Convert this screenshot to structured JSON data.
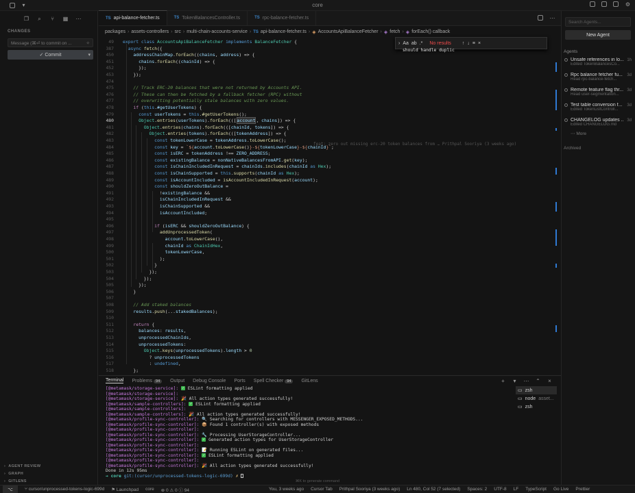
{
  "window": {
    "title": "core"
  },
  "sidebar": {
    "section_title": "CHANGES",
    "commit_placeholder": "Message (⌘⏎ to commit on ...",
    "commit_button": "✓ Commit",
    "bottom_sections": [
      "AGENT REVIEW",
      "GRAPH",
      "GITLENS"
    ]
  },
  "tabs": [
    {
      "name": "api-balance-fetcher.ts",
      "active": true
    },
    {
      "name": "TokenBalancesController.ts",
      "active": false
    },
    {
      "name": "rpc-balance-fetcher.ts",
      "active": false
    }
  ],
  "breadcrumbs": [
    "packages",
    "assets-controllers",
    "src",
    "multi-chain-accounts-service",
    "api-balance-fetcher.ts",
    "AccountsApiBalanceFetcher",
    "fetch",
    "forEach() callback"
  ],
  "find": {
    "term": "should handle duplicate",
    "case_label": "Aa",
    "result": "No results"
  },
  "code": {
    "line_numbers": [
      "49",
      "387",
      "450",
      "451",
      "452",
      "453",
      "474",
      "475",
      "476",
      "477",
      "478",
      "479",
      "480",
      "481",
      "482",
      "483",
      "484",
      "485",
      "486",
      "487",
      "488",
      "489",
      "490",
      "491",
      "492",
      "493",
      "494",
      "495",
      "496",
      "497",
      "498",
      "499",
      "500",
      "501",
      "502",
      "503",
      "504",
      "505",
      "506",
      "507",
      "508",
      "509",
      "510",
      "511",
      "512",
      "513",
      "514",
      "515",
      "516",
      "517",
      "518",
      "519"
    ],
    "current_line": "480",
    "blame": "feat: zero out missing erc-20 token balances from … Prithpal Sooriya (3 weeks ago)"
  },
  "panel": {
    "tabs": [
      {
        "label": "Terminal",
        "active": true
      },
      {
        "label": "Problems",
        "badge": "94"
      },
      {
        "label": "Output"
      },
      {
        "label": "Debug Console"
      },
      {
        "label": "Ports"
      },
      {
        "label": "Spell Checker",
        "badge": "94"
      },
      {
        "label": "GitLens"
      }
    ],
    "terminal_lines": [
      {
        "pkg": "[@metamask/storage-service]:",
        "ok": true,
        "msg": "ESLint formatting applied"
      },
      {
        "pkg": "[@metamask/storage-service]:",
        "ok": false,
        "msg": ""
      },
      {
        "pkg": "[@metamask/storage-service]:",
        "ok": false,
        "msg": "🎉 All action types generated successfully!"
      },
      {
        "pkg": "[@metamask/sample-controllers]:",
        "ok": true,
        "msg": "ESLint formatting applied"
      },
      {
        "pkg": "[@metamask/sample-controllers]:",
        "ok": false,
        "msg": ""
      },
      {
        "pkg": "[@metamask/sample-controllers]:",
        "ok": false,
        "msg": "🎉 All action types generated successfully!"
      },
      {
        "pkg": "[@metamask/profile-sync-controller]:",
        "ok": false,
        "msg": "🔍 Searching for controllers with MESSENGER_EXPOSED_METHODS..."
      },
      {
        "pkg": "[@metamask/profile-sync-controller]:",
        "ok": false,
        "msg": "📦 Found 1 controller(s) with exposed methods"
      },
      {
        "pkg": "[@metamask/profile-sync-controller]:",
        "ok": false,
        "msg": ""
      },
      {
        "pkg": "[@metamask/profile-sync-controller]:",
        "ok": false,
        "msg": "🔧 Processing UserStorageController..."
      },
      {
        "pkg": "[@metamask/profile-sync-controller]:",
        "ok": true,
        "msg": "Generated action types for UserStorageController"
      },
      {
        "pkg": "[@metamask/profile-sync-controller]:",
        "ok": false,
        "msg": ""
      },
      {
        "pkg": "[@metamask/profile-sync-controller]:",
        "ok": false,
        "msg": "📝 Running ESLint on generated files..."
      },
      {
        "pkg": "[@metamask/profile-sync-controller]:",
        "ok": true,
        "msg": "ESLint formatting applied"
      },
      {
        "pkg": "[@metamask/profile-sync-controller]:",
        "ok": false,
        "msg": ""
      },
      {
        "pkg": "[@metamask/profile-sync-controller]:",
        "ok": false,
        "msg": "🎉 All action types generated successfully!"
      }
    ],
    "done_line": "Done in 12s 95ms",
    "prompt": {
      "arrow": "→",
      "dir": "core",
      "git": "git:(cursor/unprocessed-tokens-logic-699d)",
      "suffix": "✗"
    },
    "terminals": [
      {
        "name": "zsh",
        "detail": ""
      },
      {
        "name": "node",
        "detail": "asset..."
      },
      {
        "name": "zsh",
        "detail": ""
      }
    ]
  },
  "agents": {
    "search_placeholder": "Search Agents...",
    "new_button": "New Agent",
    "heading": "Agents",
    "items": [
      {
        "title": "Unsafe references in lo...",
        "sub": "Edited TokenBalancesCo...",
        "age": "1h"
      },
      {
        "title": "Rpc balance fetcher fu...",
        "sub": "Read rpc-balance-fetch...",
        "age": "3d"
      },
      {
        "title": "Remote feature flag thr...",
        "sub": "Read user-segmentation...",
        "age": "3d"
      },
      {
        "title": "Test table conversion f...",
        "sub": "Edited TokenListControll...",
        "age": "3d"
      },
      {
        "title": "CHANGELOG updates ...",
        "sub": "Edited CHANGELOG.md",
        "age": "3d"
      }
    ],
    "more": "More",
    "archived": "Archived"
  },
  "hint": "⌘K to generate command",
  "status": {
    "branch": "cursor/unprocessed-tokens-logic-699d",
    "launchpad": "Launchpad",
    "core": "core",
    "problems": "⊗ 0 ⚠ 0 ⓘ 94",
    "blame": "You, 3 weeks ago",
    "cursor_tab": "Cursor Tab",
    "author": "Prithpal Sooriya (3 weeks ago)",
    "position": "Ln 480, Col 52 (7 selected)",
    "spaces": "Spaces: 2",
    "encoding": "UTF-8",
    "eol": "LF",
    "lang": "TypeScript",
    "golive": "Go Live",
    "prettier": "Prettier"
  }
}
